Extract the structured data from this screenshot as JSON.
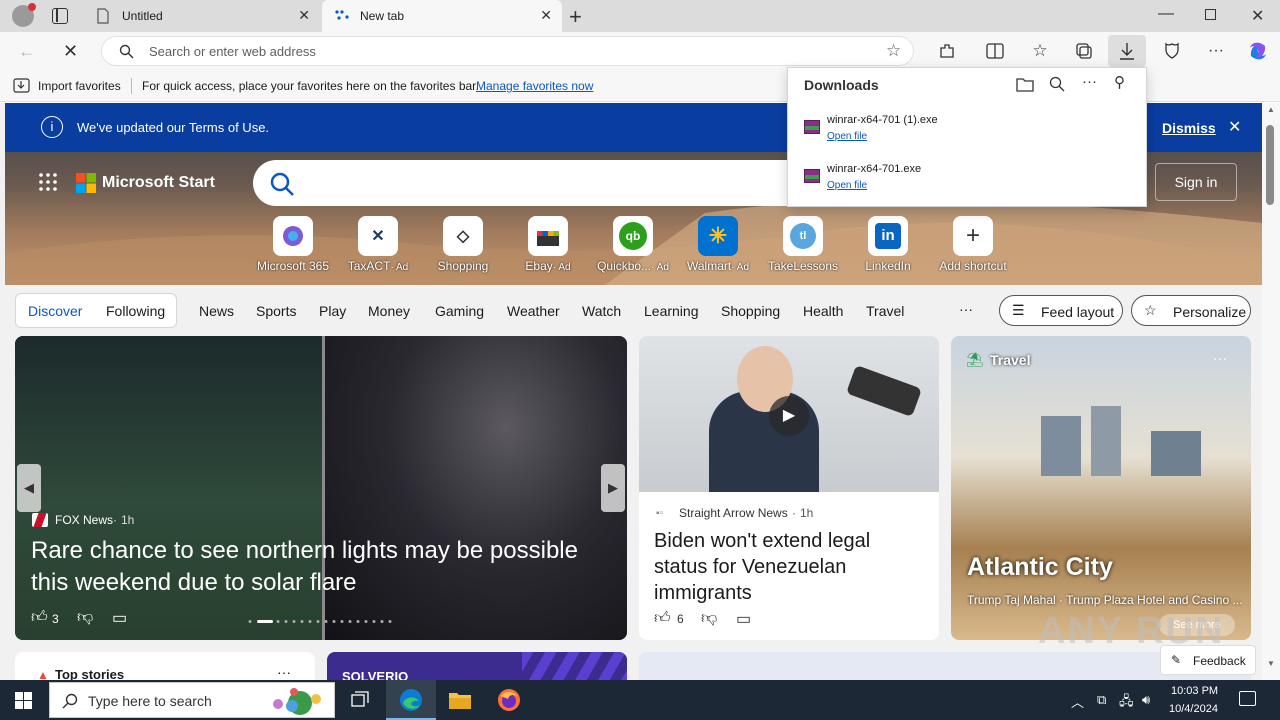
{
  "tabs": [
    {
      "label": "Untitled"
    },
    {
      "label": "New tab"
    }
  ],
  "address": {
    "placeholder": "Search or enter web address"
  },
  "favorites": {
    "import_label": "Import favorites",
    "hint": "For quick access, place your favorites here on the favorites bar.",
    "manage_link": "Manage favorites now"
  },
  "banner": {
    "text": "We've updated our Terms of Use.",
    "dismiss": "Dismiss"
  },
  "brand": {
    "name": "Microsoft Start",
    "sign_in": "Sign in"
  },
  "shortcuts": [
    {
      "label": "Microsoft 365",
      "ad": ""
    },
    {
      "label": "TaxACT",
      "ad": "· Ad"
    },
    {
      "label": "Shopping",
      "ad": ""
    },
    {
      "label": "Ebay",
      "ad": "· Ad"
    },
    {
      "label": "Quickbo...",
      "ad": "· Ad"
    },
    {
      "label": "Walmart",
      "ad": "· Ad"
    },
    {
      "label": "TakeLessons",
      "ad": ""
    },
    {
      "label": "LinkedIn",
      "ad": ""
    },
    {
      "label": "Add shortcut",
      "ad": ""
    }
  ],
  "nav": {
    "discover": "Discover",
    "following": "Following",
    "items": [
      "News",
      "Sports",
      "Play",
      "Money",
      "Gaming",
      "Weather",
      "Watch",
      "Learning",
      "Shopping",
      "Health",
      "Travel"
    ],
    "more": "···",
    "feed_layout": "Feed layout",
    "personalize": "Personalize"
  },
  "cards": {
    "main": {
      "source": "FOX News",
      "time": "1h",
      "title": "Rare chance to see northern lights may be possible this weekend due to solar flare",
      "likes": "3"
    },
    "news": {
      "source": "Straight Arrow News",
      "time": "1h",
      "title": "Biden won't extend legal status for Venezuelan immigrants",
      "likes": "6"
    },
    "travel": {
      "tag": "Travel",
      "title": "Atlantic City",
      "subtitle": "Trump Taj Mahal · Trump Plaza Hotel and Casino ...",
      "see_more": "See more"
    },
    "top_stories": "Top stories",
    "solverio": "SOLVERIO",
    "feedback": "Feedback"
  },
  "downloads": {
    "title": "Downloads",
    "items": [
      {
        "name": "winrar-x64-701 (1).exe",
        "action": "Open file"
      },
      {
        "name": "winrar-x64-701.exe",
        "action": "Open file"
      }
    ]
  },
  "taskbar": {
    "search_placeholder": "Type here to search",
    "time": "10:03 PM",
    "date": "10/4/2024"
  },
  "colors": {
    "banner": "#0a3da0",
    "accent": "#0a58c2",
    "taskbar": "#1c2836"
  },
  "watermark": "ANY RUN"
}
